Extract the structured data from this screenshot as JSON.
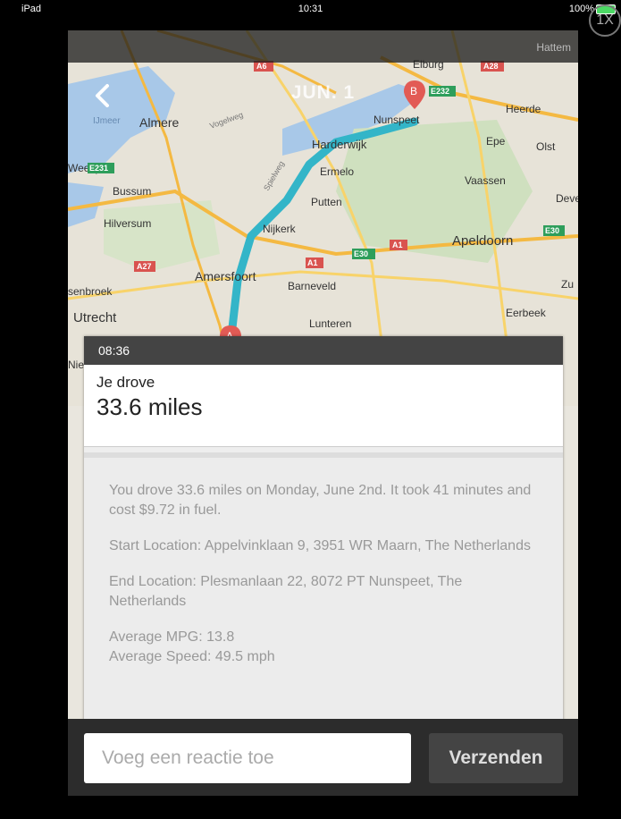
{
  "status": {
    "device": "iPad",
    "time": "10:31",
    "battery": "100%"
  },
  "zoom_badge": "1X",
  "nav": {
    "title": "JUN. 1",
    "corner": "Hattem"
  },
  "map": {
    "places": [
      "Elburg",
      "Almere",
      "IJmeer",
      "Nunspeet",
      "Heerde",
      "Harderwijk",
      "Epe",
      "Olst",
      "Ermelo",
      "Vaassen",
      "Weesp",
      "Bussum",
      "Putten",
      "Dever",
      "Hilversum",
      "Nijkerk",
      "Apeldoorn",
      "Amersfoort",
      "Barneveld",
      "Zu",
      "senbroek",
      "Utrecht",
      "Lunteren",
      "Eerbeek",
      "Nie",
      "Vogelweg",
      "Spielweg"
    ],
    "road_badges": [
      "A6",
      "A28",
      "E232",
      "E231",
      "E30",
      "A1",
      "A27",
      "E30",
      "A1"
    ],
    "markers": {
      "start": "A",
      "end": "B"
    }
  },
  "trip": {
    "time": "08:36",
    "label": "Je drove",
    "distance": "33.6 miles",
    "summary": "You drove 33.6 miles on Monday, June 2nd. It took 41 minutes and cost $9.72 in fuel.",
    "start": "Start Location: Appelvinklaan 9, 3951 WR Maarn, The Netherlands",
    "end": "End Location: Plesmanlaan 22, 8072 PT Nunspeet, The Netherlands",
    "mpg": "Average MPG: 13.8",
    "speed": "Average Speed: 49.5 mph"
  },
  "comment": {
    "placeholder": "Voeg een reactie toe",
    "send_label": "Verzenden"
  },
  "colors": {
    "route": "#33b5c8",
    "marker": "#e25b55",
    "header": "#444444"
  }
}
